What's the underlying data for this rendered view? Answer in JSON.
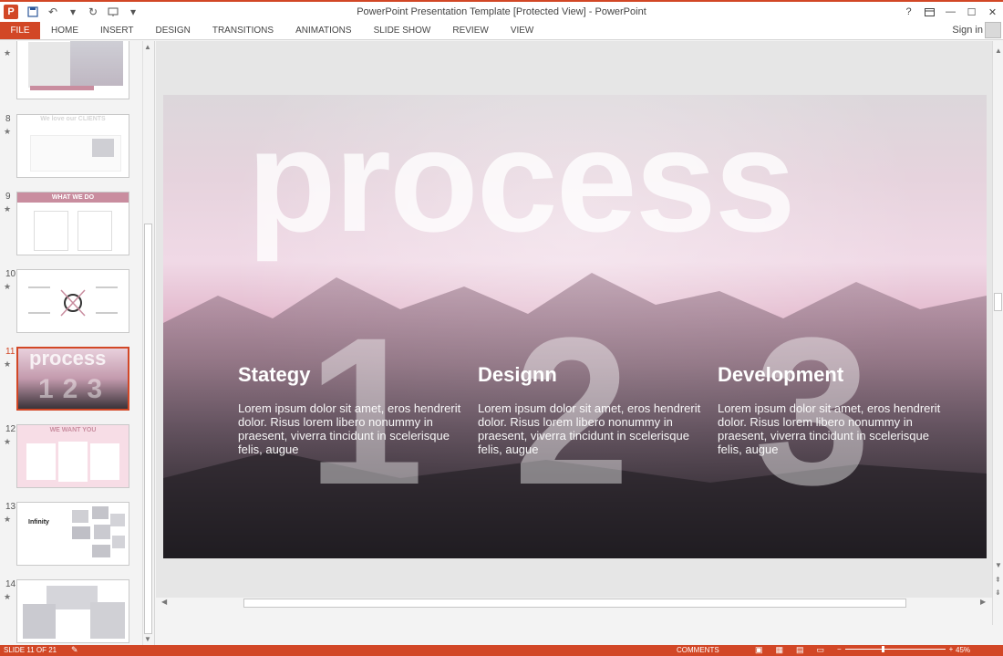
{
  "window": {
    "title": "PowerPoint Presentation Template [Protected View] - PowerPoint",
    "help": "?",
    "minimize": "—",
    "maximize": "☐",
    "close": "✕"
  },
  "ribbon": {
    "file_label": "FILE",
    "tabs": [
      "HOME",
      "INSERT",
      "DESIGN",
      "TRANSITIONS",
      "ANIMATIONS",
      "SLIDE SHOW",
      "REVIEW",
      "VIEW"
    ],
    "signin_label": "Sign in"
  },
  "thumbnails": [
    {
      "number": "",
      "caption": "",
      "active": false
    },
    {
      "number": "8",
      "caption": "We love our CLIENTS",
      "active": false
    },
    {
      "number": "9",
      "caption": "WHAT WE DO",
      "active": false
    },
    {
      "number": "10",
      "caption": "",
      "active": false
    },
    {
      "number": "11",
      "caption": "process",
      "active": true
    },
    {
      "number": "12",
      "caption": "WE WANT YOU",
      "active": false
    },
    {
      "number": "13",
      "caption": "Infinity",
      "active": false
    },
    {
      "number": "14",
      "caption": "",
      "active": false
    }
  ],
  "slide": {
    "headline": "process",
    "numbers": [
      "1",
      "2",
      "3"
    ],
    "columns": [
      {
        "title": "Stategy",
        "body": "Lorem ipsum dolor sit amet, eros hendrerit dolor. Risus lorem libero nonummy in praesent, viverra tincidunt in scelerisque felis, augue"
      },
      {
        "title": "Designn",
        "body": "Lorem ipsum dolor sit amet, eros hendrerit dolor. Risus lorem libero nonummy in praesent, viverra tincidunt in scelerisque felis, augue"
      },
      {
        "title": "Development",
        "body": "Lorem ipsum dolor sit amet, eros hendrerit dolor. Risus lorem libero nonummy in praesent, viverra tincidunt in scelerisque felis, augue"
      }
    ]
  },
  "status": {
    "slide_count": "SLIDE 11 OF 21",
    "comments_label": "COMMENTS",
    "zoom_level": "45%"
  },
  "colors": {
    "accent": "#d24726"
  },
  "icons": {
    "app": "powerpoint-icon",
    "save": "save-icon",
    "undo": "undo-icon",
    "redo": "redo-icon",
    "present": "present-from-beginning-icon"
  }
}
